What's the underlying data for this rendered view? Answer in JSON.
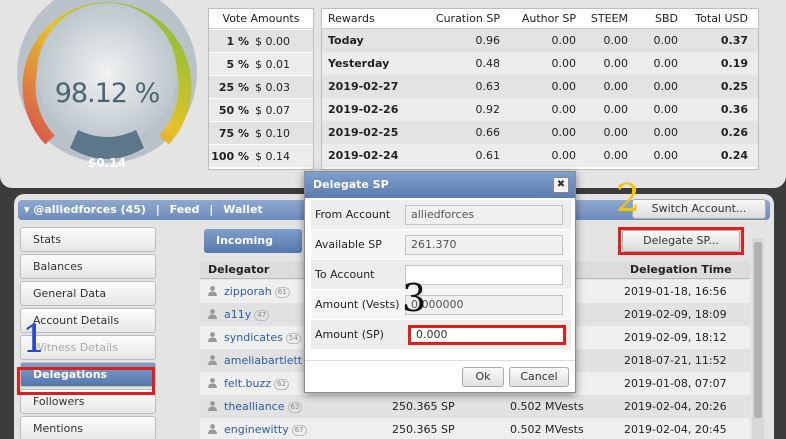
{
  "gauge": {
    "value": "98.12 %",
    "sub_value": "$0.14",
    "level_percent": 98.12,
    "colors": {
      "red": "#d9534f",
      "yellow": "#e6c229",
      "green": "#7bbf3a"
    }
  },
  "vote_amounts": {
    "header": "Vote Amounts",
    "rows": [
      {
        "pct": "1 %",
        "usd": "$ 0.00"
      },
      {
        "pct": "5 %",
        "usd": "$ 0.01"
      },
      {
        "pct": "25 %",
        "usd": "$ 0.03"
      },
      {
        "pct": "50 %",
        "usd": "$ 0.07"
      },
      {
        "pct": "75 %",
        "usd": "$ 0.10"
      },
      {
        "pct": "100 %",
        "usd": "$ 0.14"
      }
    ]
  },
  "rewards": {
    "headers": [
      "Rewards",
      "Curation SP",
      "Author SP",
      "STEEM",
      "SBD",
      "Total USD"
    ],
    "rows": [
      [
        "Today",
        "0.96",
        "0.00",
        "0.00",
        "0.00",
        "0.37"
      ],
      [
        "Yesterday",
        "0.48",
        "0.00",
        "0.00",
        "0.00",
        "0.19"
      ],
      [
        "2019-02-27",
        "0.63",
        "0.00",
        "0.00",
        "0.00",
        "0.25"
      ],
      [
        "2019-02-26",
        "0.92",
        "0.00",
        "0.00",
        "0.00",
        "0.36"
      ],
      [
        "2019-02-25",
        "0.66",
        "0.00",
        "0.00",
        "0.00",
        "0.26"
      ],
      [
        "2019-02-24",
        "0.61",
        "0.00",
        "0.00",
        "0.00",
        "0.24"
      ]
    ]
  },
  "account_bar": {
    "account": "@alliedforces (45)",
    "feed": "Feed",
    "wallet": "Wallet",
    "separator": "|"
  },
  "switch_account": "Switch Account...",
  "sidebar": {
    "items": [
      {
        "label": "Stats"
      },
      {
        "label": "Balances"
      },
      {
        "label": "General Data"
      },
      {
        "label": "Account Details"
      },
      {
        "label": "Witness Details"
      },
      {
        "label": "Delegations"
      },
      {
        "label": "Followers"
      },
      {
        "label": "Mentions"
      }
    ]
  },
  "delegations": {
    "incoming_tab": "Incoming",
    "delegate_button": "Delegate SP...",
    "col_delegator": "Delegator",
    "col_time": "Delegation Time",
    "rows": [
      {
        "user": "zipporah",
        "rep": "61",
        "sp": "",
        "vests": "",
        "time": "2019-01-18, 16:56"
      },
      {
        "user": "a11y",
        "rep": "47",
        "sp": "",
        "vests": "",
        "time": "2019-02-09, 18:09"
      },
      {
        "user": "syndicates",
        "rep": "54",
        "sp": "",
        "vests": "",
        "time": "2019-02-09, 18:12"
      },
      {
        "user": "ameliabartlett",
        "rep": "",
        "sp": "",
        "vests": "",
        "time": "2018-07-21, 11:52"
      },
      {
        "user": "felt.buzz",
        "rep": "62",
        "sp": "",
        "vests": "",
        "time": "2019-01-08, 07:07"
      },
      {
        "user": "thealliance",
        "rep": "63",
        "sp": "250.365 SP",
        "vests": "0.502 MVests",
        "time": "2019-02-04, 20:26"
      },
      {
        "user": "enginewitty",
        "rep": "67",
        "sp": "250.365 SP",
        "vests": "0.502 MVests",
        "time": "2019-02-04, 20:45"
      }
    ]
  },
  "modal": {
    "title": "Delegate SP",
    "close_glyph": "✖",
    "from_account_label": "From Account",
    "from_account_value": "alliedforces",
    "available_sp_label": "Available SP",
    "available_sp_value": "261.370",
    "to_account_label": "To Account",
    "to_account_value": "",
    "amount_vests_label": "Amount (Vests)",
    "amount_vests_value": "0.000000",
    "amount_sp_label": "Amount (SP)",
    "amount_sp_value": "0.000",
    "ok": "Ok",
    "cancel": "Cancel"
  },
  "annotations": {
    "step1": "1",
    "step2": "2",
    "step3": "3",
    "highlight_color": "#e31c1c"
  }
}
